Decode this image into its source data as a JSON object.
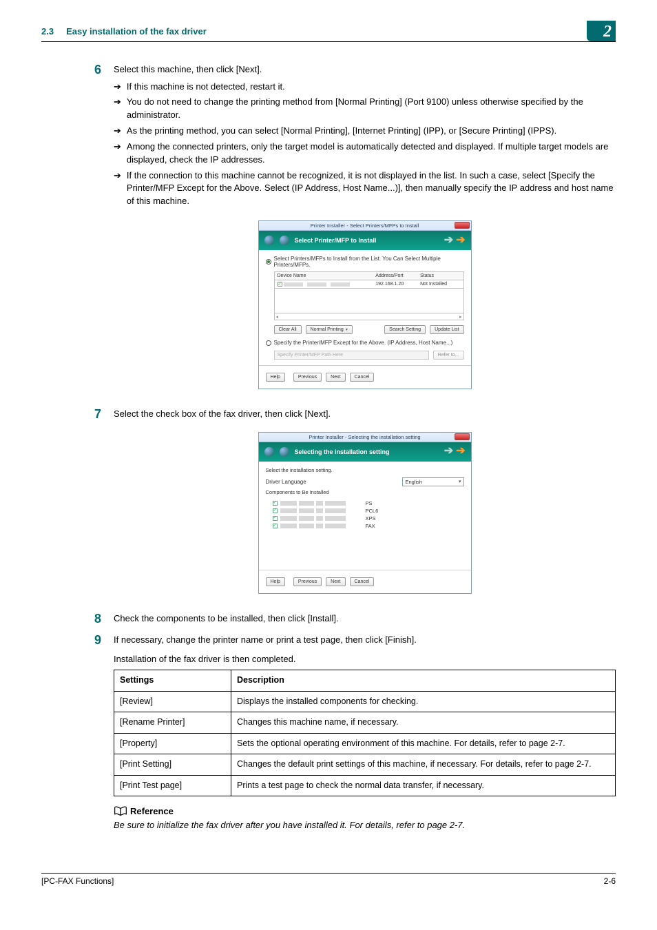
{
  "header": {
    "section_num": "2.3",
    "section_title": "Easy installation of the fax driver",
    "chapter_badge": "2"
  },
  "steps": {
    "s6": {
      "num": "6",
      "text": "Select this machine, then click [Next].",
      "subs": [
        "If this machine is not detected, restart it.",
        "You do not need to change the printing method from [Normal Printing] (Port 9100) unless otherwise specified by the administrator.",
        "As the printing method, you can select [Normal Printing], [Internet Printing] (IPP), or [Secure Printing] (IPPS).",
        "Among the connected printers, only the target model is automatically detected and displayed. If multiple target models are displayed, check the IP addresses.",
        "If the connection to this machine cannot be recognized, it is not displayed in the list. In such a case, select [Specify the Printer/MFP Except for the Above. Select (IP Address, Host Name...)], then manually specify the IP address and host name of this machine."
      ]
    },
    "s7": {
      "num": "7",
      "text": "Select the check box of the fax driver, then click [Next]."
    },
    "s8": {
      "num": "8",
      "text": "Check the components to be installed, then click [Install]."
    },
    "s9": {
      "num": "9",
      "text": "If necessary, change the printer name or print a test page, then click [Finish].",
      "extra": "Installation of the fax driver is then completed."
    }
  },
  "dialog1": {
    "title": "Printer Installer - Select Printers/MFPs to Install",
    "banner": "Select Printer/MFP to Install",
    "radio_main": "Select Printers/MFPs to Install from the List. You Can Select Multiple Printers/MFPs.",
    "cols": {
      "c1": "Device Name",
      "c2": "Address/Port",
      "c3": "Status"
    },
    "row": {
      "addr": "192.168.1.20",
      "status": "Not Installed"
    },
    "clear_all": "Clear All",
    "normal_printing": "Normal Printing",
    "search_setting": "Search Setting",
    "update_list": "Update List",
    "radio_specify": "Specify the Printer/MFP Except for the Above. (IP Address, Host Name...)",
    "specify_placeholder": "Specify Printer/MFP Path Here",
    "refer_to": "Refer to...",
    "help": "Help",
    "previous": "Previous",
    "next": "Next",
    "cancel": "Cancel"
  },
  "dialog2": {
    "title": "Printer Installer - Selecting the installation setting",
    "banner": "Selecting the installation setting",
    "select_label": "Select the installation setting.",
    "driver_lang_label": "Driver Language",
    "driver_lang_value": "English",
    "components_label": "Components to Be Installed",
    "components": [
      "PS",
      "PCL6",
      "XPS",
      "FAX"
    ],
    "help": "Help",
    "previous": "Previous",
    "next": "Next",
    "cancel": "Cancel"
  },
  "table": {
    "head": {
      "c1": "Settings",
      "c2": "Description"
    },
    "rows": [
      {
        "c1": "[Review]",
        "c2": "Displays the installed components for checking."
      },
      {
        "c1": "[Rename Printer]",
        "c2": "Changes this machine name, if necessary."
      },
      {
        "c1": "[Property]",
        "c2": "Sets the optional operating environment of this machine. For details, refer to page 2-7."
      },
      {
        "c1": "[Print Setting]",
        "c2": "Changes the default print settings of this machine, if necessary. For details, refer to page 2-7."
      },
      {
        "c1": "[Print Test page]",
        "c2": "Prints a test page to check the normal data transfer, if necessary."
      }
    ]
  },
  "reference": {
    "heading": "Reference",
    "text": "Be sure to initialize the fax driver after you have installed it. For details, refer to page 2-7."
  },
  "footer": {
    "left": "[PC-FAX Functions]",
    "right": "2-6"
  }
}
